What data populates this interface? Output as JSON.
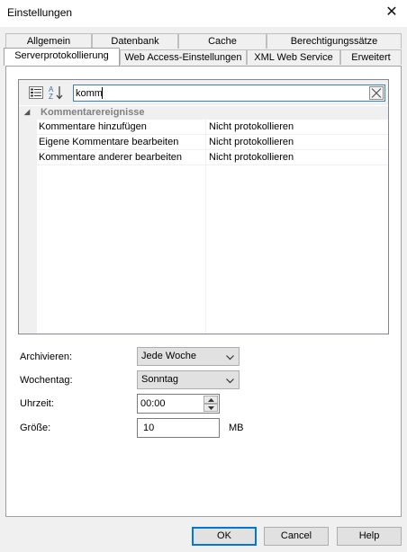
{
  "window": {
    "title": "Einstellungen",
    "close_glyph": "✕"
  },
  "tabs": {
    "row_back": [
      {
        "label": "Allgemein"
      },
      {
        "label": "Datenbank"
      },
      {
        "label": "Cache"
      },
      {
        "label": "Berechtigungssätze"
      }
    ],
    "row_front": [
      {
        "label": "Serverprotokollierung",
        "active": true
      },
      {
        "label": "Web Access-Einstellungen"
      },
      {
        "label": "XML Web Service"
      },
      {
        "label": "Erweitert"
      }
    ]
  },
  "property_grid": {
    "toolbar": {
      "categorized_icon": "categorized-view-icon",
      "alphabetical_icon": "sort-alphabetical-icon",
      "alphabetical_top": "A",
      "alphabetical_bottom": "Z"
    },
    "search": {
      "value": "komm",
      "clear_icon": "clear-search-icon"
    },
    "category": {
      "label": "Kommentarereignisse",
      "toggle": "◢"
    },
    "rows": [
      {
        "name": "Kommentare hinzufügen",
        "value": "Nicht protokollieren"
      },
      {
        "name": "Eigene Kommentare bearbeiten",
        "value": "Nicht protokollieren"
      },
      {
        "name": "Kommentare anderer bearbeiten",
        "value": "Nicht protokollieren"
      }
    ]
  },
  "form": {
    "archive": {
      "label": "Archivieren:",
      "value": "Jede Woche"
    },
    "weekday": {
      "label": "Wochentag:",
      "value": "Sonntag"
    },
    "time": {
      "label": "Uhrzeit:",
      "value": "00:00"
    },
    "size": {
      "label": "Größe:",
      "value": "10",
      "unit": "MB"
    }
  },
  "buttons": {
    "ok": "OK",
    "cancel": "Cancel",
    "help": "Help"
  },
  "colors": {
    "accent": "#0078d7",
    "search_border": "#3c7fb1"
  }
}
